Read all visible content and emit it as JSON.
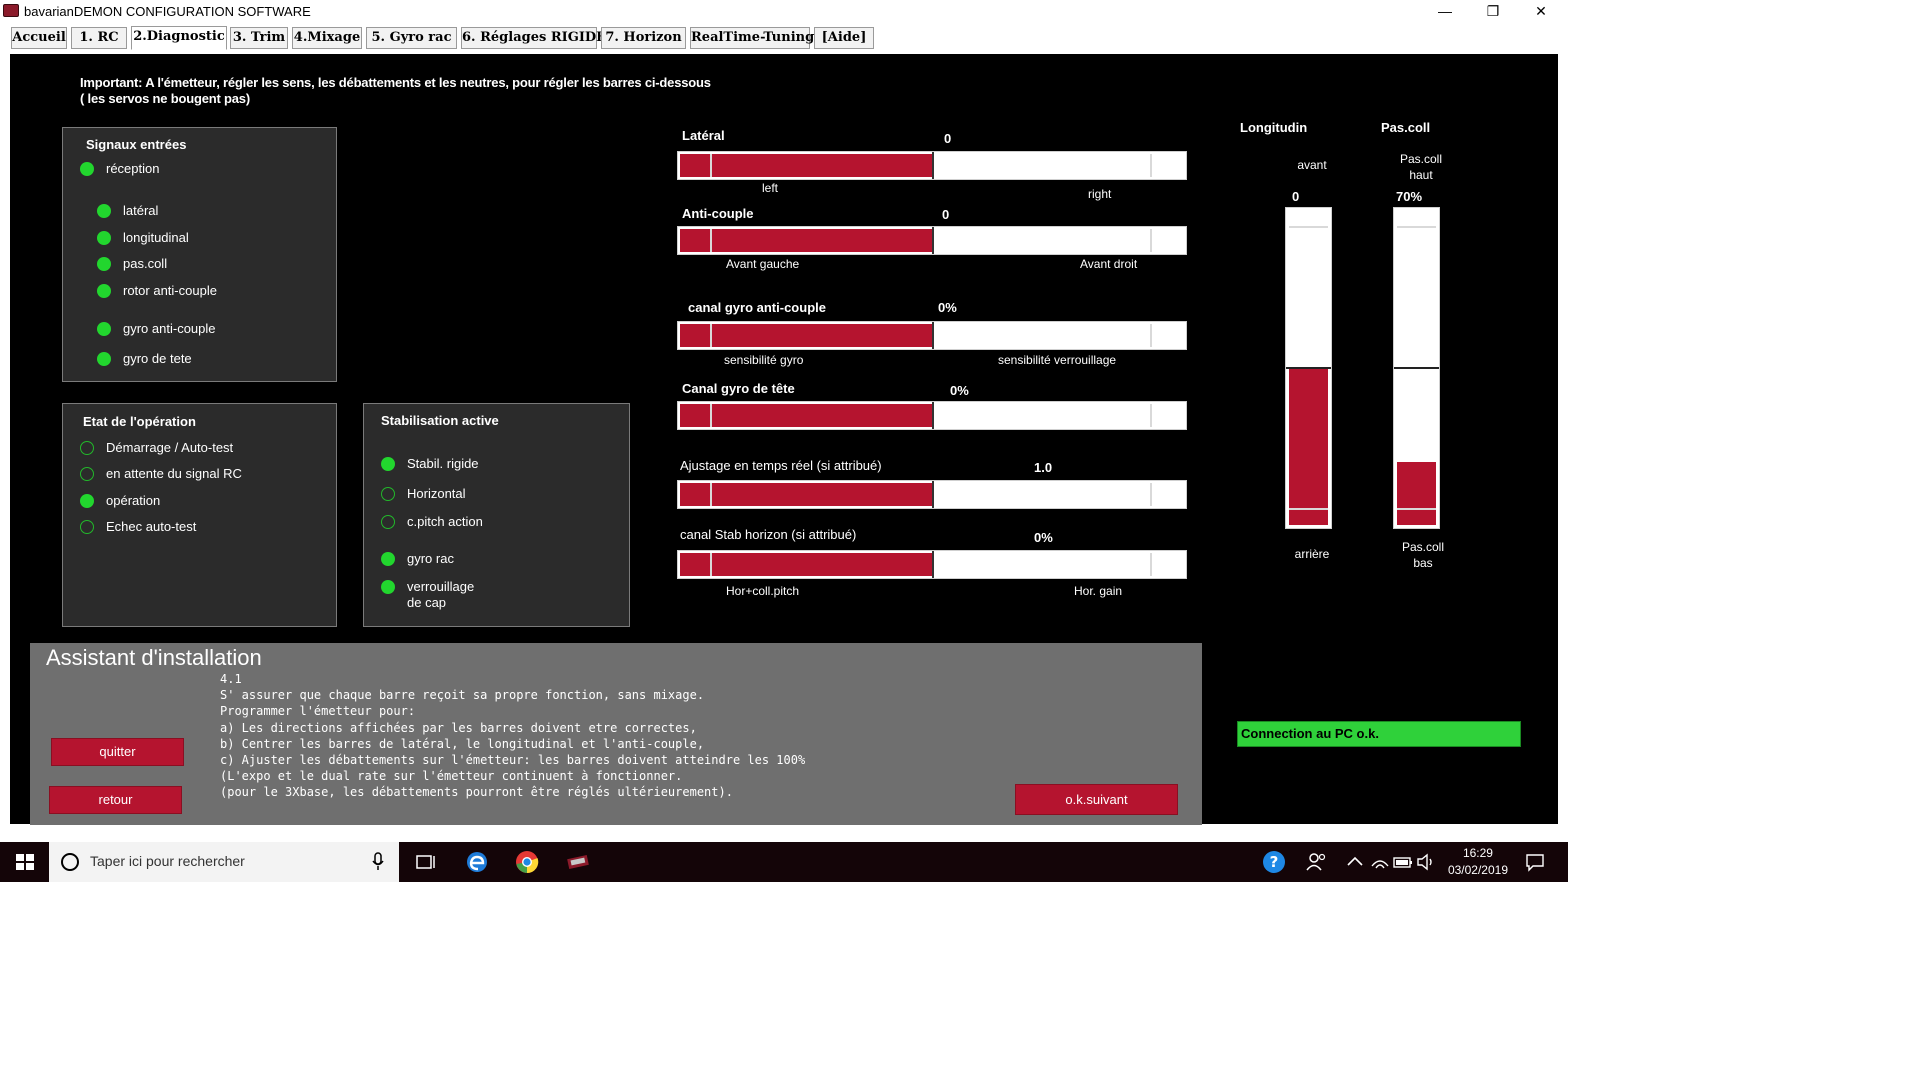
{
  "window": {
    "title": "bavarianDEMON CONFIGURATION SOFTWARE",
    "min": "—",
    "restore": "❐",
    "close": "✕"
  },
  "tabs": [
    {
      "label": "Accueil"
    },
    {
      "label": "1. RC"
    },
    {
      "label": "2.Diagnostic",
      "active": true
    },
    {
      "label": "3. Trim"
    },
    {
      "label": "4.Mixage"
    },
    {
      "label": "5. Gyro rac"
    },
    {
      "label": "6. Réglages RIGIDE"
    },
    {
      "label": "7. Horizon"
    },
    {
      "label": "RealTime-Tuning"
    },
    {
      "label": "[Aide]"
    }
  ],
  "note": {
    "line1": "Important: A l'émetteur, régler les sens, les débattements et les neutres, pour régler les barres ci-dessous",
    "line2": "( les servos ne bougent pas)"
  },
  "signals": {
    "title": "Signaux entrées",
    "items": [
      {
        "label": "réception",
        "on": true
      },
      {
        "label": "latéral",
        "on": true
      },
      {
        "label": "longitudinal",
        "on": true
      },
      {
        "label": "pas.coll",
        "on": true
      },
      {
        "label": "rotor anti-couple",
        "on": true
      },
      {
        "label": "gyro anti-couple",
        "on": true
      },
      {
        "label": "gyro de tete",
        "on": true
      }
    ]
  },
  "operation": {
    "title": "Etat de l'opération",
    "items": [
      {
        "label": "Démarrage / Auto-test",
        "on": false
      },
      {
        "label": "en attente du signal RC",
        "on": false
      },
      {
        "label": "opération",
        "on": true
      },
      {
        "label": "Echec auto-test",
        "on": false
      }
    ]
  },
  "stabilisation": {
    "title": "Stabilisation active",
    "items": [
      {
        "label": "Stabil. rigide",
        "on": true
      },
      {
        "label": "Horizontal",
        "on": false
      },
      {
        "label": "c.pitch action",
        "on": false
      },
      {
        "label": "gyro rac",
        "on": true
      },
      {
        "label": "verrouillage",
        "label2": "de cap",
        "on": true
      }
    ]
  },
  "bars": [
    {
      "label": "Latéral",
      "value": "0",
      "left": "left",
      "right": "right",
      "fill": 0.5
    },
    {
      "label": "Anti-couple",
      "value": "0",
      "left": "Avant gauche",
      "right": "Avant droit",
      "fill": 0.5
    },
    {
      "label": "canal gyro anti-couple",
      "value": "0%",
      "left": "sensibilité gyro",
      "right": "sensibilité verrouillage",
      "fill": 0.5
    },
    {
      "label": "Canal gyro de tête",
      "value": "0%",
      "left": "",
      "right": "",
      "fill": 0.5
    },
    {
      "label": "Ajustage en temps réel (si attribué)",
      "value": "1.0",
      "left": "",
      "right": "",
      "fill": 0.5
    },
    {
      "label": "canal Stab horizon (si attribué)",
      "value": "0%",
      "left": "Hor+coll.pitch",
      "right": "Hor. gain",
      "fill": 0.5
    }
  ],
  "longitudin": {
    "title": "Longitudin",
    "top": "avant",
    "value": "0",
    "bottom": "arrière",
    "fill": 0.5
  },
  "pascoll": {
    "title": "Pas.coll",
    "top": "Pas.coll",
    "top2": "haut",
    "value": "70%",
    "bottom": "Pas.coll",
    "bottom2": "bas",
    "fill": 0.2
  },
  "status": {
    "text": "Connection au PC o.k.",
    "color": "#2fd13a"
  },
  "assistant": {
    "title": "Assistant d'installation",
    "body": "4.1\nS' assurer que chaque barre reçoit sa propre fonction, sans mixage.\nProgrammer l'émetteur pour:\na) Les directions affichées par les barres doivent etre correctes,\nb) Centrer les barres de latéral, le longitudinal et l'anti-couple,\nc) Ajuster les débattements sur l'émetteur: les barres doivent atteindre les 100%\n(L'expo et le dual rate sur l'émetteur continuent à fonctionner.\n(pour le 3Xbase, les débattements pourront être réglés ultérieurement).",
    "quit": "quitter",
    "back": "retour",
    "next": "o.k.suivant"
  },
  "taskbar": {
    "search_placeholder": "Taper ici pour rechercher",
    "time": "16:29",
    "date": "03/02/2019"
  },
  "colors": {
    "bar_red": "#b5142f",
    "led_green": "#22d62e",
    "panel_bg": "#2b2b2b",
    "assistant_bg": "#6f6f6f"
  }
}
